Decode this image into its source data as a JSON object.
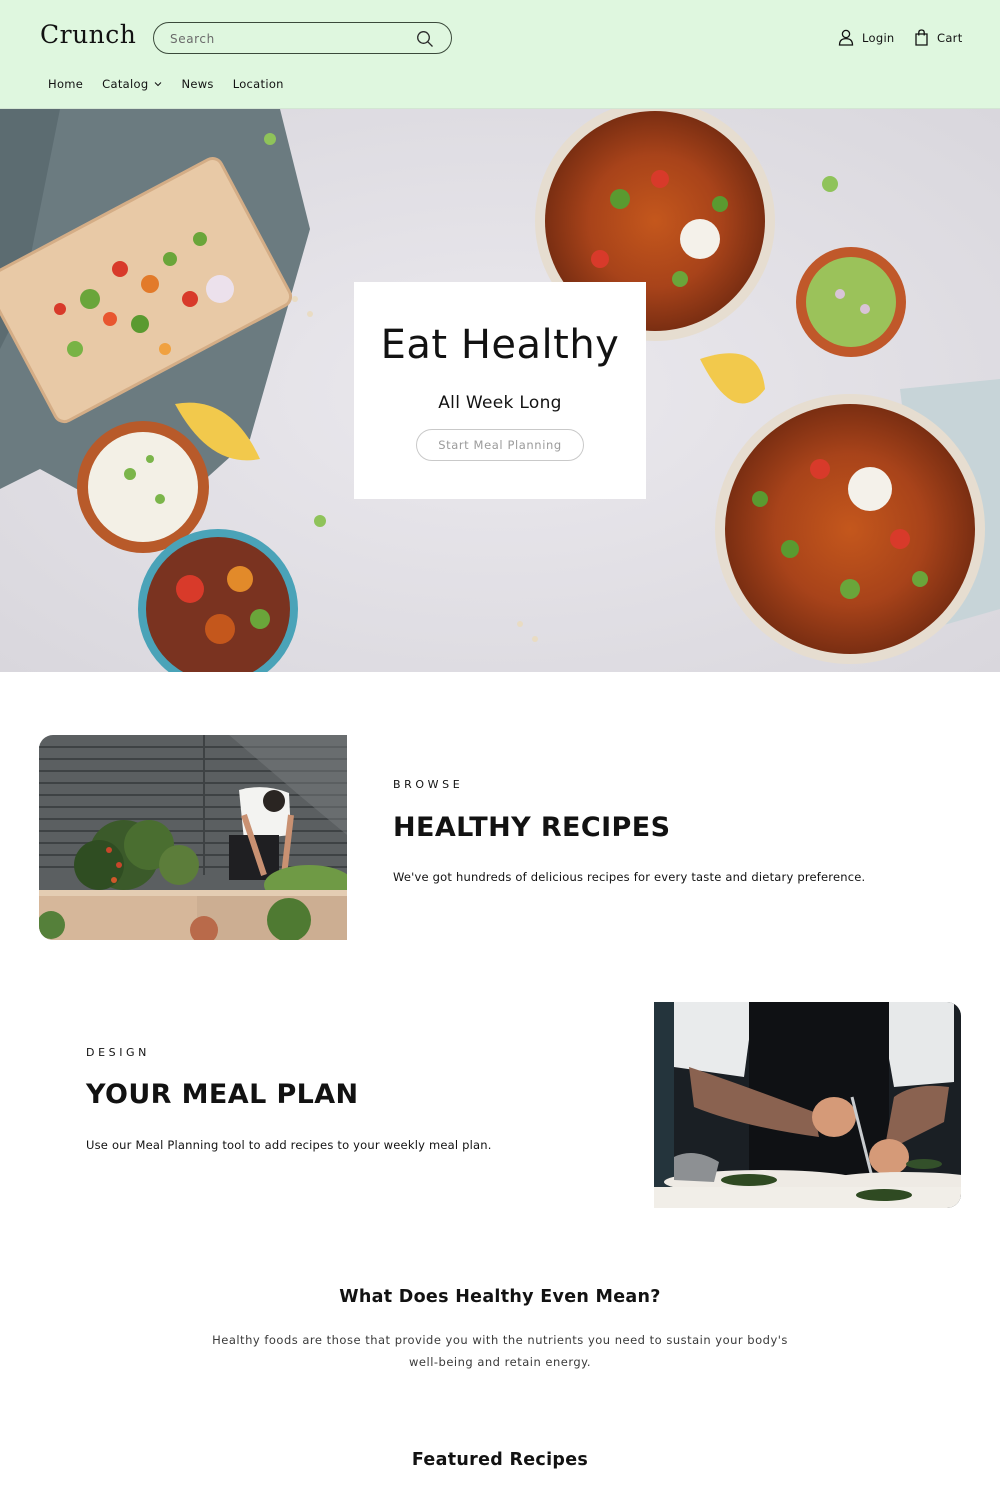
{
  "header": {
    "logo": "Crunch",
    "search": {
      "placeholder": "Search",
      "value": ""
    },
    "nav": [
      {
        "label": "Home",
        "has_dropdown": false
      },
      {
        "label": "Catalog",
        "has_dropdown": true
      },
      {
        "label": "News",
        "has_dropdown": false
      },
      {
        "label": "Location",
        "has_dropdown": false
      }
    ],
    "login_label": "Login",
    "cart_label": "Cart",
    "background_color": "#dff7df"
  },
  "hero": {
    "title": "Eat Healthy",
    "subtitle": "All Week Long",
    "button_label": "Start Meal Planning",
    "image_description": "overhead view of bowls of sweet potato fries with salsa, guacamole, yogurt dip and cutting board"
  },
  "sections": [
    {
      "eyebrow": "BROWSE",
      "title": "HEALTHY RECIPES",
      "text": "We've got hundreds of delicious recipes for every taste and dietary preference.",
      "image_description": "chef tending raised garden beds in front of grey slatted fence"
    },
    {
      "eyebrow": "DESIGN",
      "title": "YOUR MEAL PLAN",
      "text": "Use our Meal Planning tool to add recipes to your weekly meal plan.",
      "image_description": "tattooed chef plating greens with tweezers"
    }
  ],
  "about": {
    "title": "What Does Healthy Even Mean?",
    "text": "Healthy foods are those that provide you with the nutrients you need to sustain your body's well-being and retain energy."
  },
  "featured": {
    "title": "Featured Recipes"
  }
}
